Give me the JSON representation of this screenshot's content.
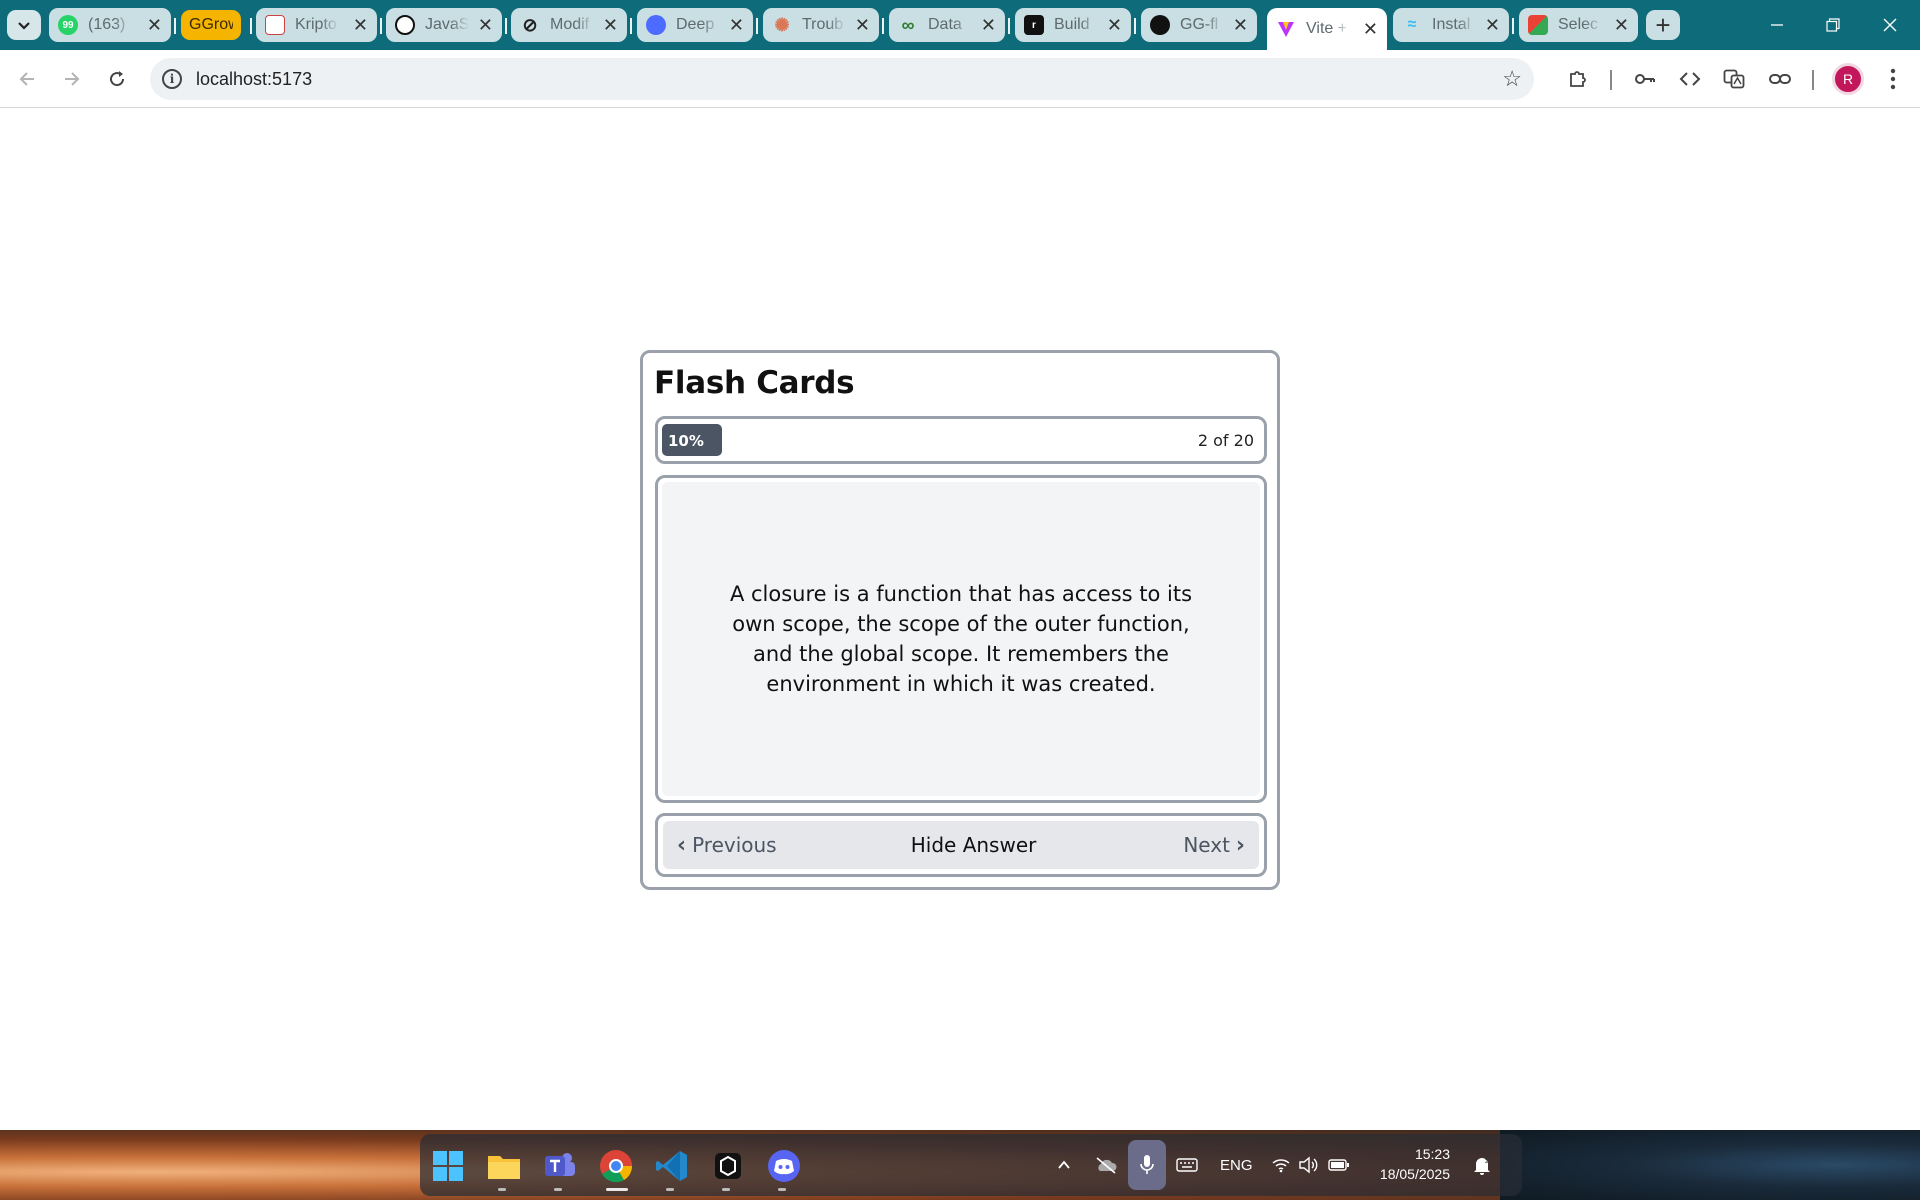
{
  "browser": {
    "tabs": [
      {
        "title": "(163)",
        "favicon": "whatsapp-icon",
        "color": "#25d366"
      },
      {
        "title": "GGrow",
        "favicon": "ggrow-badge",
        "color": "#f4b400"
      },
      {
        "title": "Kripto",
        "favicon": "document-icon",
        "color": "#ffffff"
      },
      {
        "title": "JavaS",
        "favicon": "openai-icon",
        "color": "#111111"
      },
      {
        "title": "Modif",
        "favicon": "ban-icon",
        "color": "#222222"
      },
      {
        "title": "Deep",
        "favicon": "deepseek-icon",
        "color": "#4d6bfe"
      },
      {
        "title": "Troub",
        "favicon": "claude-icon",
        "color": "#d97757"
      },
      {
        "title": "Data",
        "favicon": "infinity-icon",
        "color": "#2e7d32"
      },
      {
        "title": "Build",
        "favicon": "render-icon",
        "color": "#111111"
      },
      {
        "title": "GG-fl",
        "favicon": "github-icon",
        "color": "#111111"
      },
      {
        "title": "Vite +",
        "favicon": "vite-icon",
        "color": "#bd34fe",
        "active": true
      },
      {
        "title": "Instal",
        "favicon": "tailwind-icon",
        "color": "#38bdf8"
      },
      {
        "title": "Selec",
        "favicon": "google-icon",
        "color": "#ea4335"
      }
    ],
    "url": "localhost:5173",
    "profile_initial": "R"
  },
  "flashcards": {
    "title": "Flash Cards",
    "progress_percent": 10,
    "progress_label": "10%",
    "counter": "2 of 20",
    "card_text": "A closure is a function that has access to its own scope, the scope of the outer function, and the global scope. It remembers the environment in which it was created.",
    "prev_label": "Previous",
    "toggle_label": "Hide Answer",
    "next_label": "Next"
  },
  "taskbar": {
    "language": "ENG",
    "time": "15:23",
    "date": "18/05/2025"
  },
  "colors": {
    "chrome_frame": "#0d6b7a",
    "progress_fill": "#4b5563",
    "card_background": "#f3f4f6",
    "border": "#9aa1ab"
  }
}
